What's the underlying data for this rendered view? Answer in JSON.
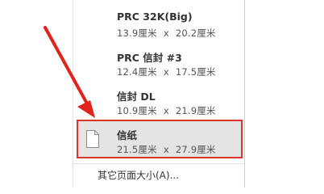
{
  "menu": {
    "items": [
      {
        "name": "PRC 32K(Big)",
        "width": "13.9厘米",
        "sep": "x",
        "height": "20.2厘米"
      },
      {
        "name": "PRC 信封 #3",
        "width": "12.4厘米",
        "sep": "x",
        "height": "17.5厘米"
      },
      {
        "name": "信封 DL",
        "width": "10.9厘米",
        "sep": "x",
        "height": "21.9厘米"
      },
      {
        "name": "信纸",
        "width": "21.5厘米",
        "sep": "x",
        "height": "27.9厘米"
      }
    ],
    "more_label": "其它页面大小(A)..."
  },
  "highlight_color": "#d9372c",
  "selected_icon": "page-icon"
}
